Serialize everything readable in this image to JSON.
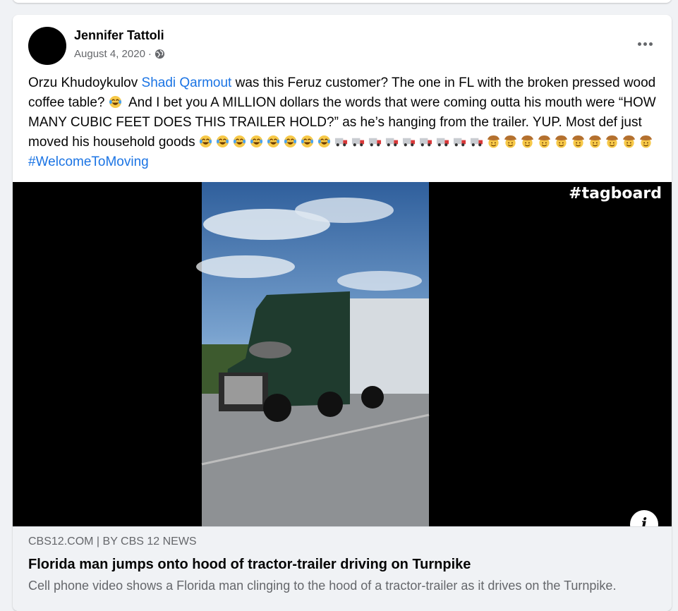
{
  "post": {
    "author": "Jennifer Tattoli",
    "date": "August 4, 2020",
    "separator": "·",
    "privacy_icon": "globe-icon",
    "text": {
      "part1": "Orzu Khudoykulov ",
      "mention": "Shadi Qarmout",
      "part2": " was this Feruz customer? The one in FL with the broken pressed wood coffee table? ",
      "part3": " And I bet you A MILLION dollars the words that were coming outta his mouth were “HOW MANY CUBIC FEET DOES THIS TRAILER HOLD?” as he’s hanging from the trailer. YUP. Most def just moved his household goods ",
      "hashtag": "#WelcomeToMoving"
    },
    "emoji": {
      "laugh_count_inline": 1,
      "laugh_count": 8,
      "truck_count": 9,
      "cowboy_count": 10
    }
  },
  "media": {
    "watermark": "#tagboard",
    "info_icon_label": "i"
  },
  "link_preview": {
    "domain": "CBS12.COM | BY CBS 12 NEWS",
    "title": "Florida man jumps onto hood of tractor-trailer driving on Turnpike",
    "description": "Cell phone video shows a Florida man clinging to the hood of a tractor-trailer as it drives on the Turnpike."
  },
  "colors": {
    "link_blue": "#1b74e4",
    "secondary_text": "#65676b",
    "background": "#f0f2f5"
  }
}
